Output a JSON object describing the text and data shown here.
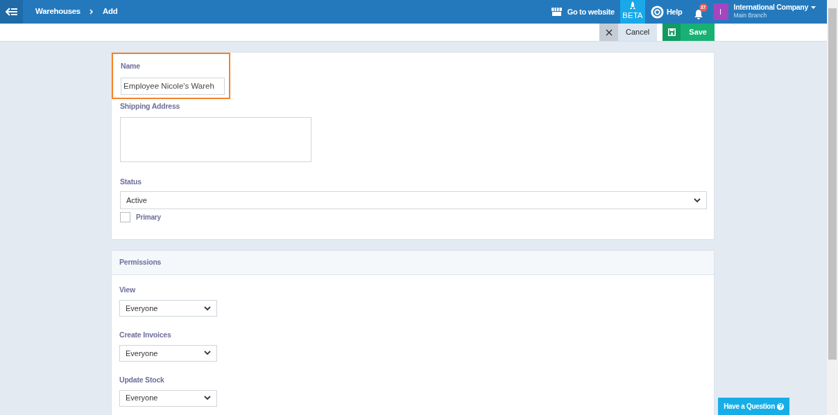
{
  "topbar": {
    "breadcrumb": [
      "Warehouses",
      "Add"
    ],
    "website_link": "Go to website",
    "beta": "BETA",
    "help": "Help",
    "notifications": "37",
    "account": {
      "initial": "I",
      "company": "International Company",
      "branch": "Main Branch"
    }
  },
  "toolbar": {
    "cancel": "Cancel",
    "save": "Save"
  },
  "form": {
    "name": {
      "label": "Name",
      "value": "Employee Nicole's Wareh",
      "highlighted": true
    },
    "shipping_address": {
      "label": "Shipping Address"
    },
    "status": {
      "label": "Status",
      "value": "Active"
    },
    "primary": {
      "label": "Primary",
      "checked": false
    }
  },
  "permissions": {
    "title": "Permissions",
    "fields": [
      {
        "label": "View",
        "value": "Everyone"
      },
      {
        "label": "Create Invoices",
        "value": "Everyone"
      },
      {
        "label": "Update Stock",
        "value": "Everyone"
      }
    ]
  },
  "help_button": "Have a Question"
}
